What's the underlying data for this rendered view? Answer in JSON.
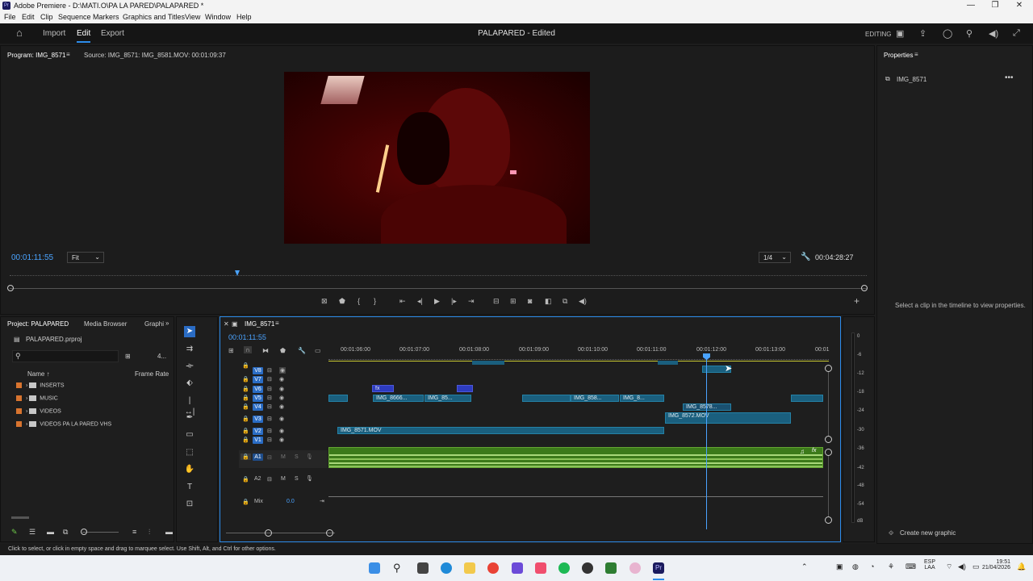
{
  "window": {
    "title": "Adobe Premiere - D:\\MATI.O\\PA LA PARED\\PALAPARED *",
    "app_icon": "Pr"
  },
  "menu": [
    "File",
    "Edit",
    "Clip",
    "Sequence",
    "Markers",
    "Graphics and Titles",
    "View",
    "Window",
    "Help"
  ],
  "header": {
    "nav": [
      "Import",
      "Edit",
      "Export"
    ],
    "active": "Edit",
    "document_title": "PALAPARED - Edited",
    "workspace": "EDITING"
  },
  "program_monitor": {
    "tab": "Program: IMG_8571",
    "source": "Source: IMG_8571: IMG_8581.MOV: 00:01:09:37",
    "current_timecode": "00:01:11:55",
    "zoom": "Fit",
    "resolution": "1/4",
    "duration": "00:04:28:27"
  },
  "properties": {
    "title": "Properties",
    "clip_name": "IMG_8571",
    "hint": "Select a clip in the timeline to view properties.",
    "create_graphic": "Create new graphic"
  },
  "project": {
    "tabs": [
      "Project: PALAPARED",
      "Media Browser",
      "Graphi"
    ],
    "file": "PALAPARED.prproj",
    "count": "4...",
    "col_name": "Name",
    "col_rate": "Frame Rate",
    "folders": [
      "INSERTS",
      "MUSIC",
      "VIDEOS",
      "VIDEOS PA LA PARED VHS"
    ],
    "folder_color": "#d8742f"
  },
  "timeline": {
    "tab": "IMG_8571",
    "timecode": "00:01:11:55",
    "ruler": [
      "00:01:06:00",
      "00:01:07:00",
      "00:01:08:00",
      "00:01:09:00",
      "00:01:10:00",
      "00:01:11:00",
      "00:01:12:00",
      "00:01:13:00",
      "00:01"
    ],
    "video_tracks": [
      "V8",
      "V7",
      "V6",
      "V5",
      "V4",
      "V3",
      "V2",
      "V1"
    ],
    "audio_tracks": [
      "A1",
      "A2"
    ],
    "mix_label": "Mix",
    "mix_value": "0.0",
    "clips": {
      "v5_a": "IMG_8666...",
      "v5_b": "IMG_85...",
      "v5_c": "IMG_858...",
      "v5_d": "IMG_8...",
      "v4": "IMG_8578...",
      "v3": "IMG_8572.MOV",
      "v2": "IMG_8571.MOV",
      "fx": "fx"
    },
    "meter": [
      "0",
      "-6",
      "-12",
      "-18",
      "-24",
      "-30",
      "-36",
      "-42",
      "-48",
      "-54",
      "dB"
    ]
  },
  "status": "Click to select, or click in empty space and drag to marquee select. Use Shift, Alt, and Ctrl for other options.",
  "taskbar": {
    "lang": "ESP",
    "lang2": "LAA",
    "time": "19:51",
    "date": "21/04/2026"
  }
}
